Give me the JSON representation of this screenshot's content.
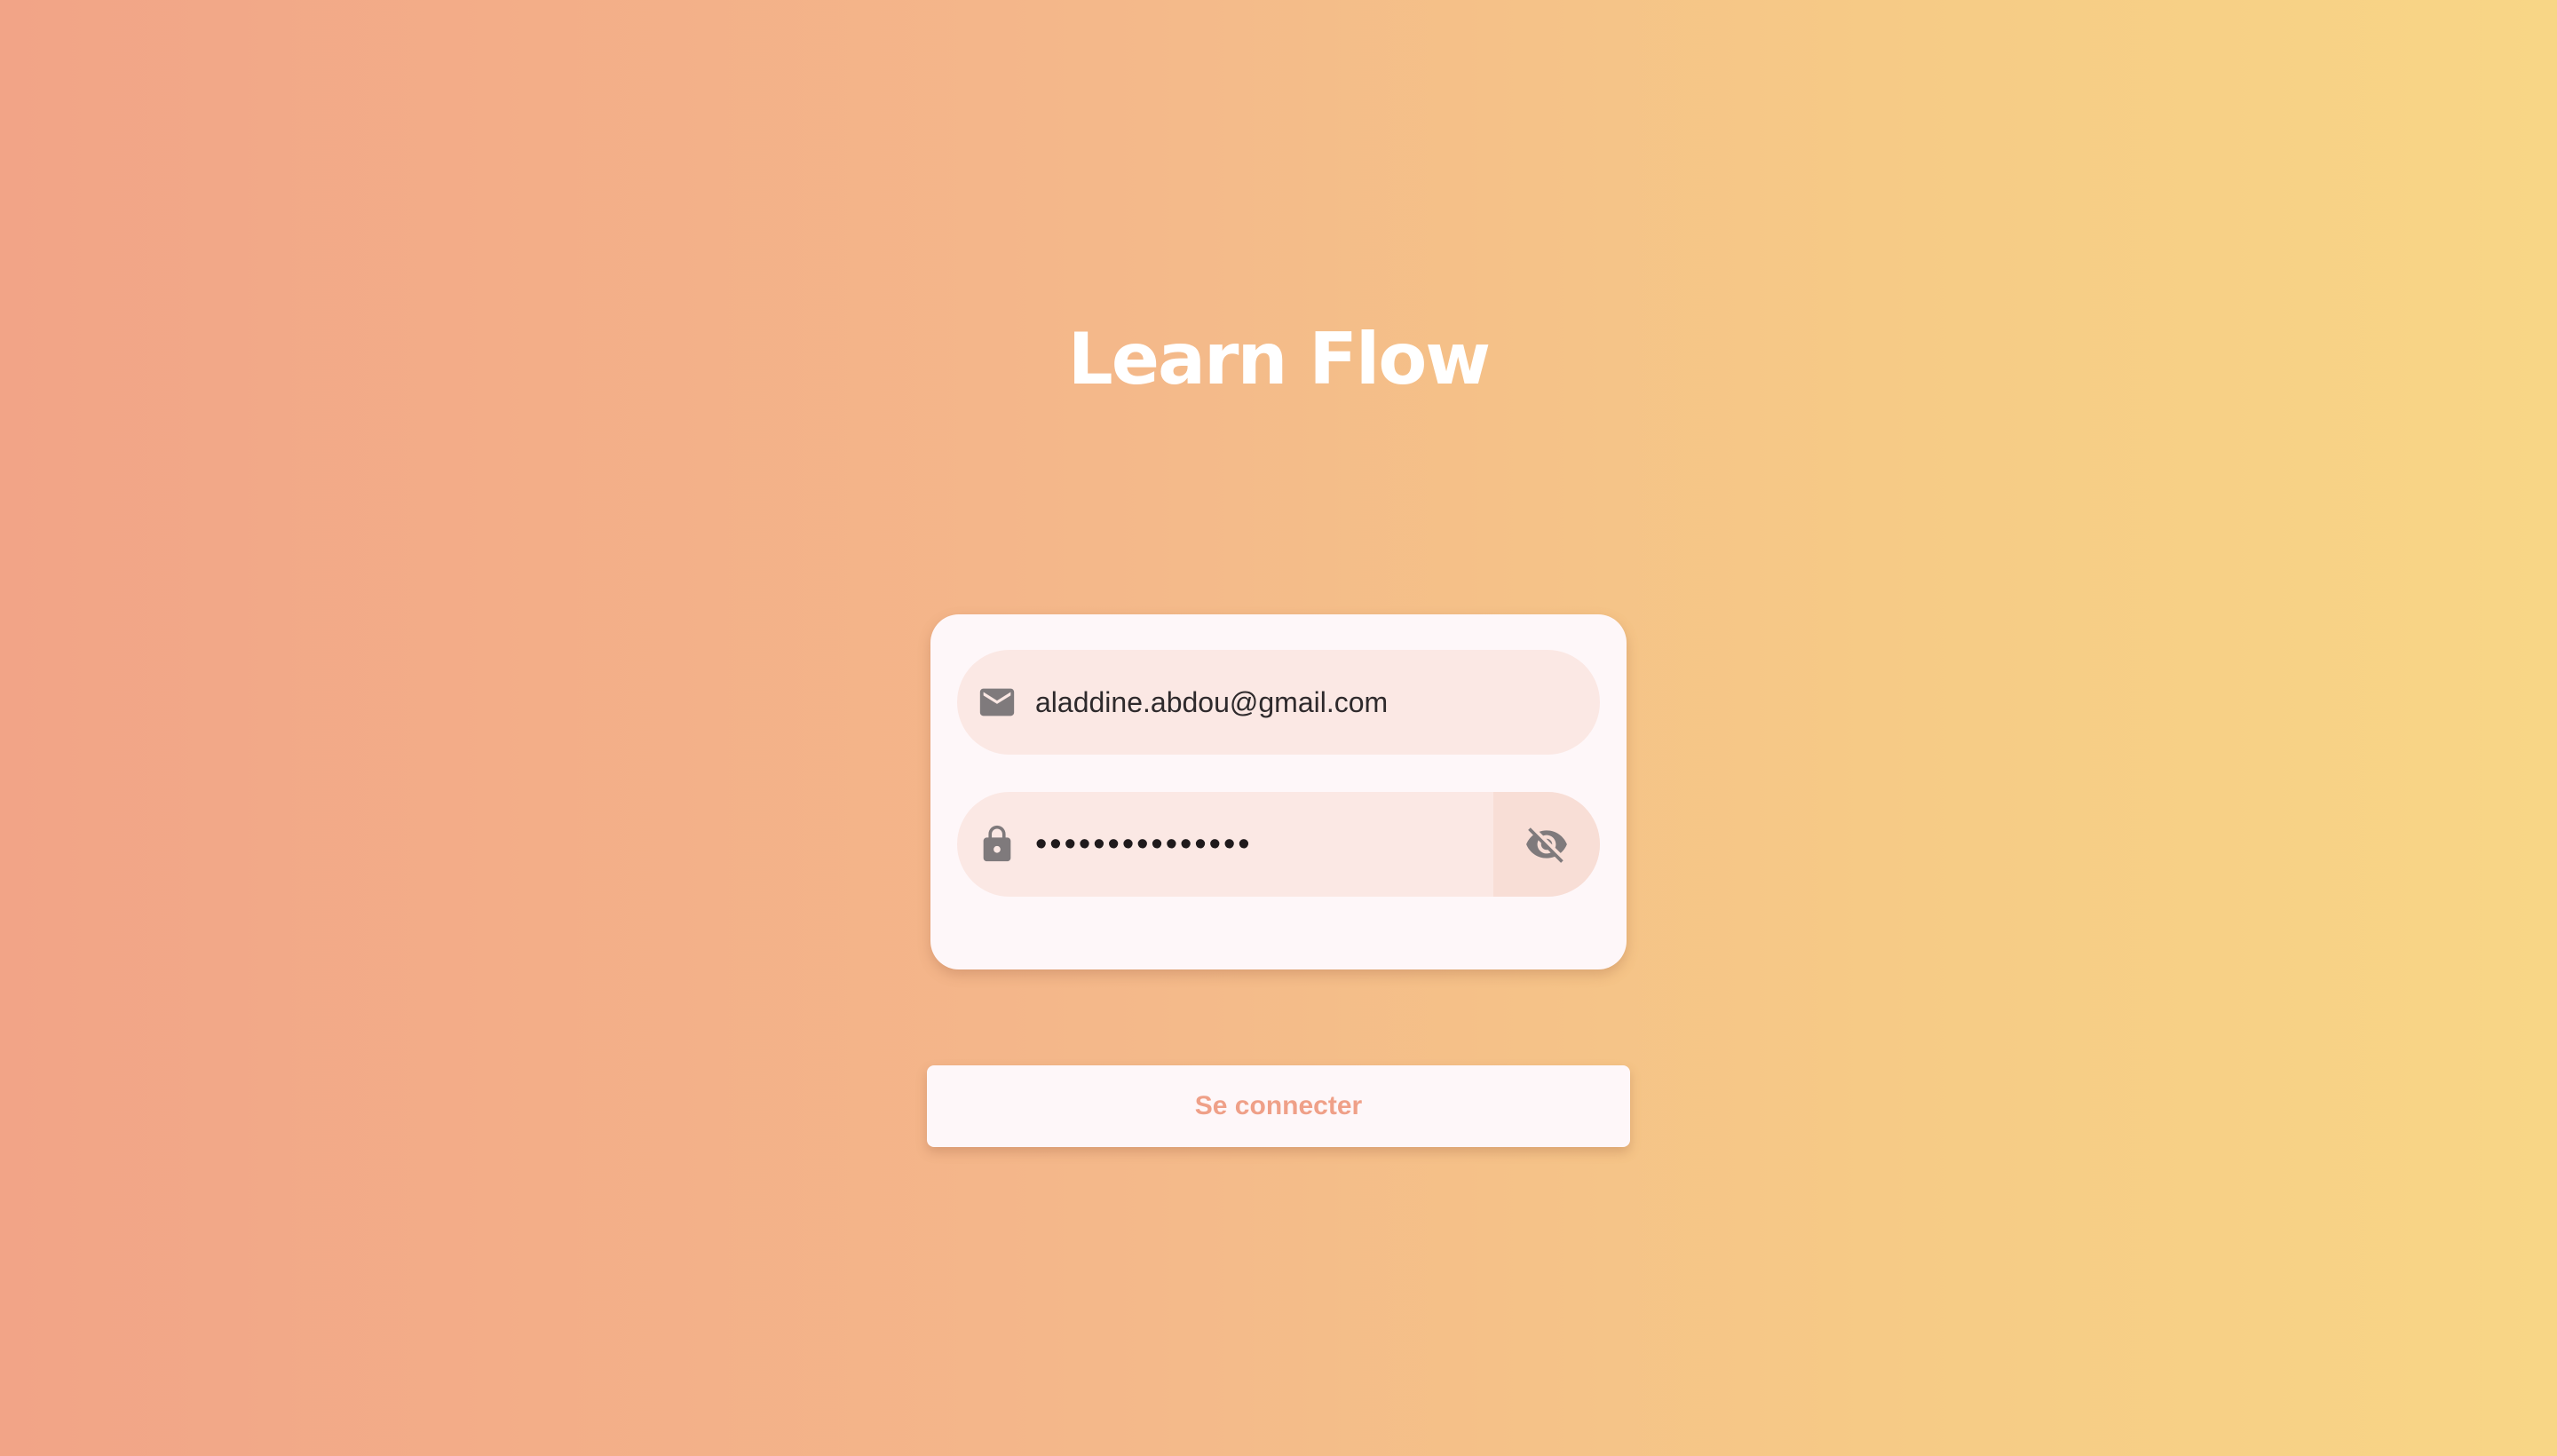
{
  "app": {
    "title": "Learn Flow"
  },
  "login_form": {
    "email": {
      "icon": "mail-icon",
      "value": "aladdine.abdou@gmail.com"
    },
    "password": {
      "icon": "lock-icon",
      "value": "•••••••••••••••",
      "visibility_toggle_icon": "eye-off-icon"
    },
    "submit_label": "Se connecter"
  },
  "colors": {
    "background_gradient_start": "#F2A487",
    "background_gradient_end": "#F8D686",
    "card_background": "#FEF7F9",
    "field_background": "#FBE8E4",
    "accent_text": "#EFA088"
  }
}
